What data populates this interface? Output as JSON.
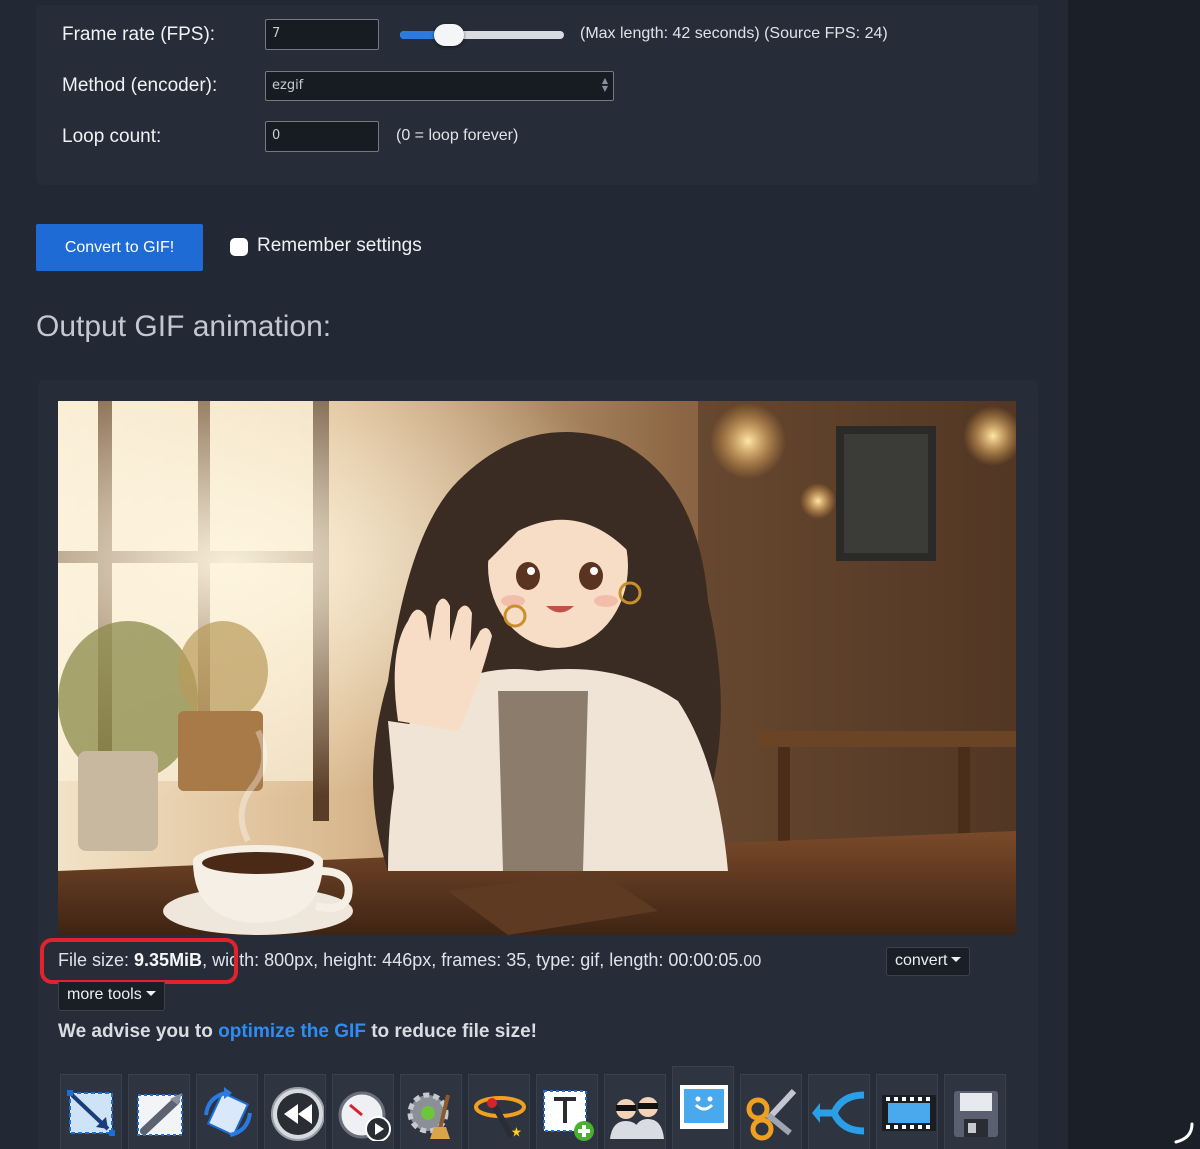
{
  "settings": {
    "fps_label": "Frame rate (FPS):",
    "fps_value": "7",
    "fps_slider_fraction": 0.3,
    "fps_hint": "(Max length: 42 seconds) (Source FPS: 24)",
    "method_label": "Method (encoder):",
    "method_value": "ezgif",
    "loop_label": "Loop count:",
    "loop_value": "0",
    "loop_hint": "(0 = loop forever)"
  },
  "actions": {
    "convert_label": "Convert to GIF!",
    "remember_label": "Remember settings",
    "remember_checked": false
  },
  "output": {
    "title": "Output GIF animation:",
    "file_size_label": "File size: ",
    "file_size_value": "9.35MiB",
    "file_details": ", width: 800px, height: 446px, frames: 35, type: gif, length: 00:00:05.",
    "file_details_ms": "00",
    "convert_menu": "convert",
    "more_tools_menu": "more tools",
    "advice_prefix": "We advise you to ",
    "advice_link": "optimize the GIF",
    "advice_suffix": " to reduce file size!"
  },
  "tools": [
    {
      "icon": "crop-icon"
    },
    {
      "icon": "resize-icon"
    },
    {
      "icon": "rotate-icon"
    },
    {
      "icon": "reverse-icon"
    },
    {
      "icon": "speed-icon"
    },
    {
      "icon": "optimize-icon"
    },
    {
      "icon": "effects-icon"
    },
    {
      "icon": "add-text-icon"
    },
    {
      "icon": "censor-icon"
    },
    {
      "icon": "frames-icon"
    },
    {
      "icon": "cut-icon"
    },
    {
      "icon": "split-icon"
    },
    {
      "icon": "filmstrip-icon"
    },
    {
      "icon": "save-icon"
    }
  ],
  "colors": {
    "accent": "#1e6bd6",
    "link": "#2f8cf2",
    "highlight": "#e4222d",
    "background": "#222834"
  }
}
